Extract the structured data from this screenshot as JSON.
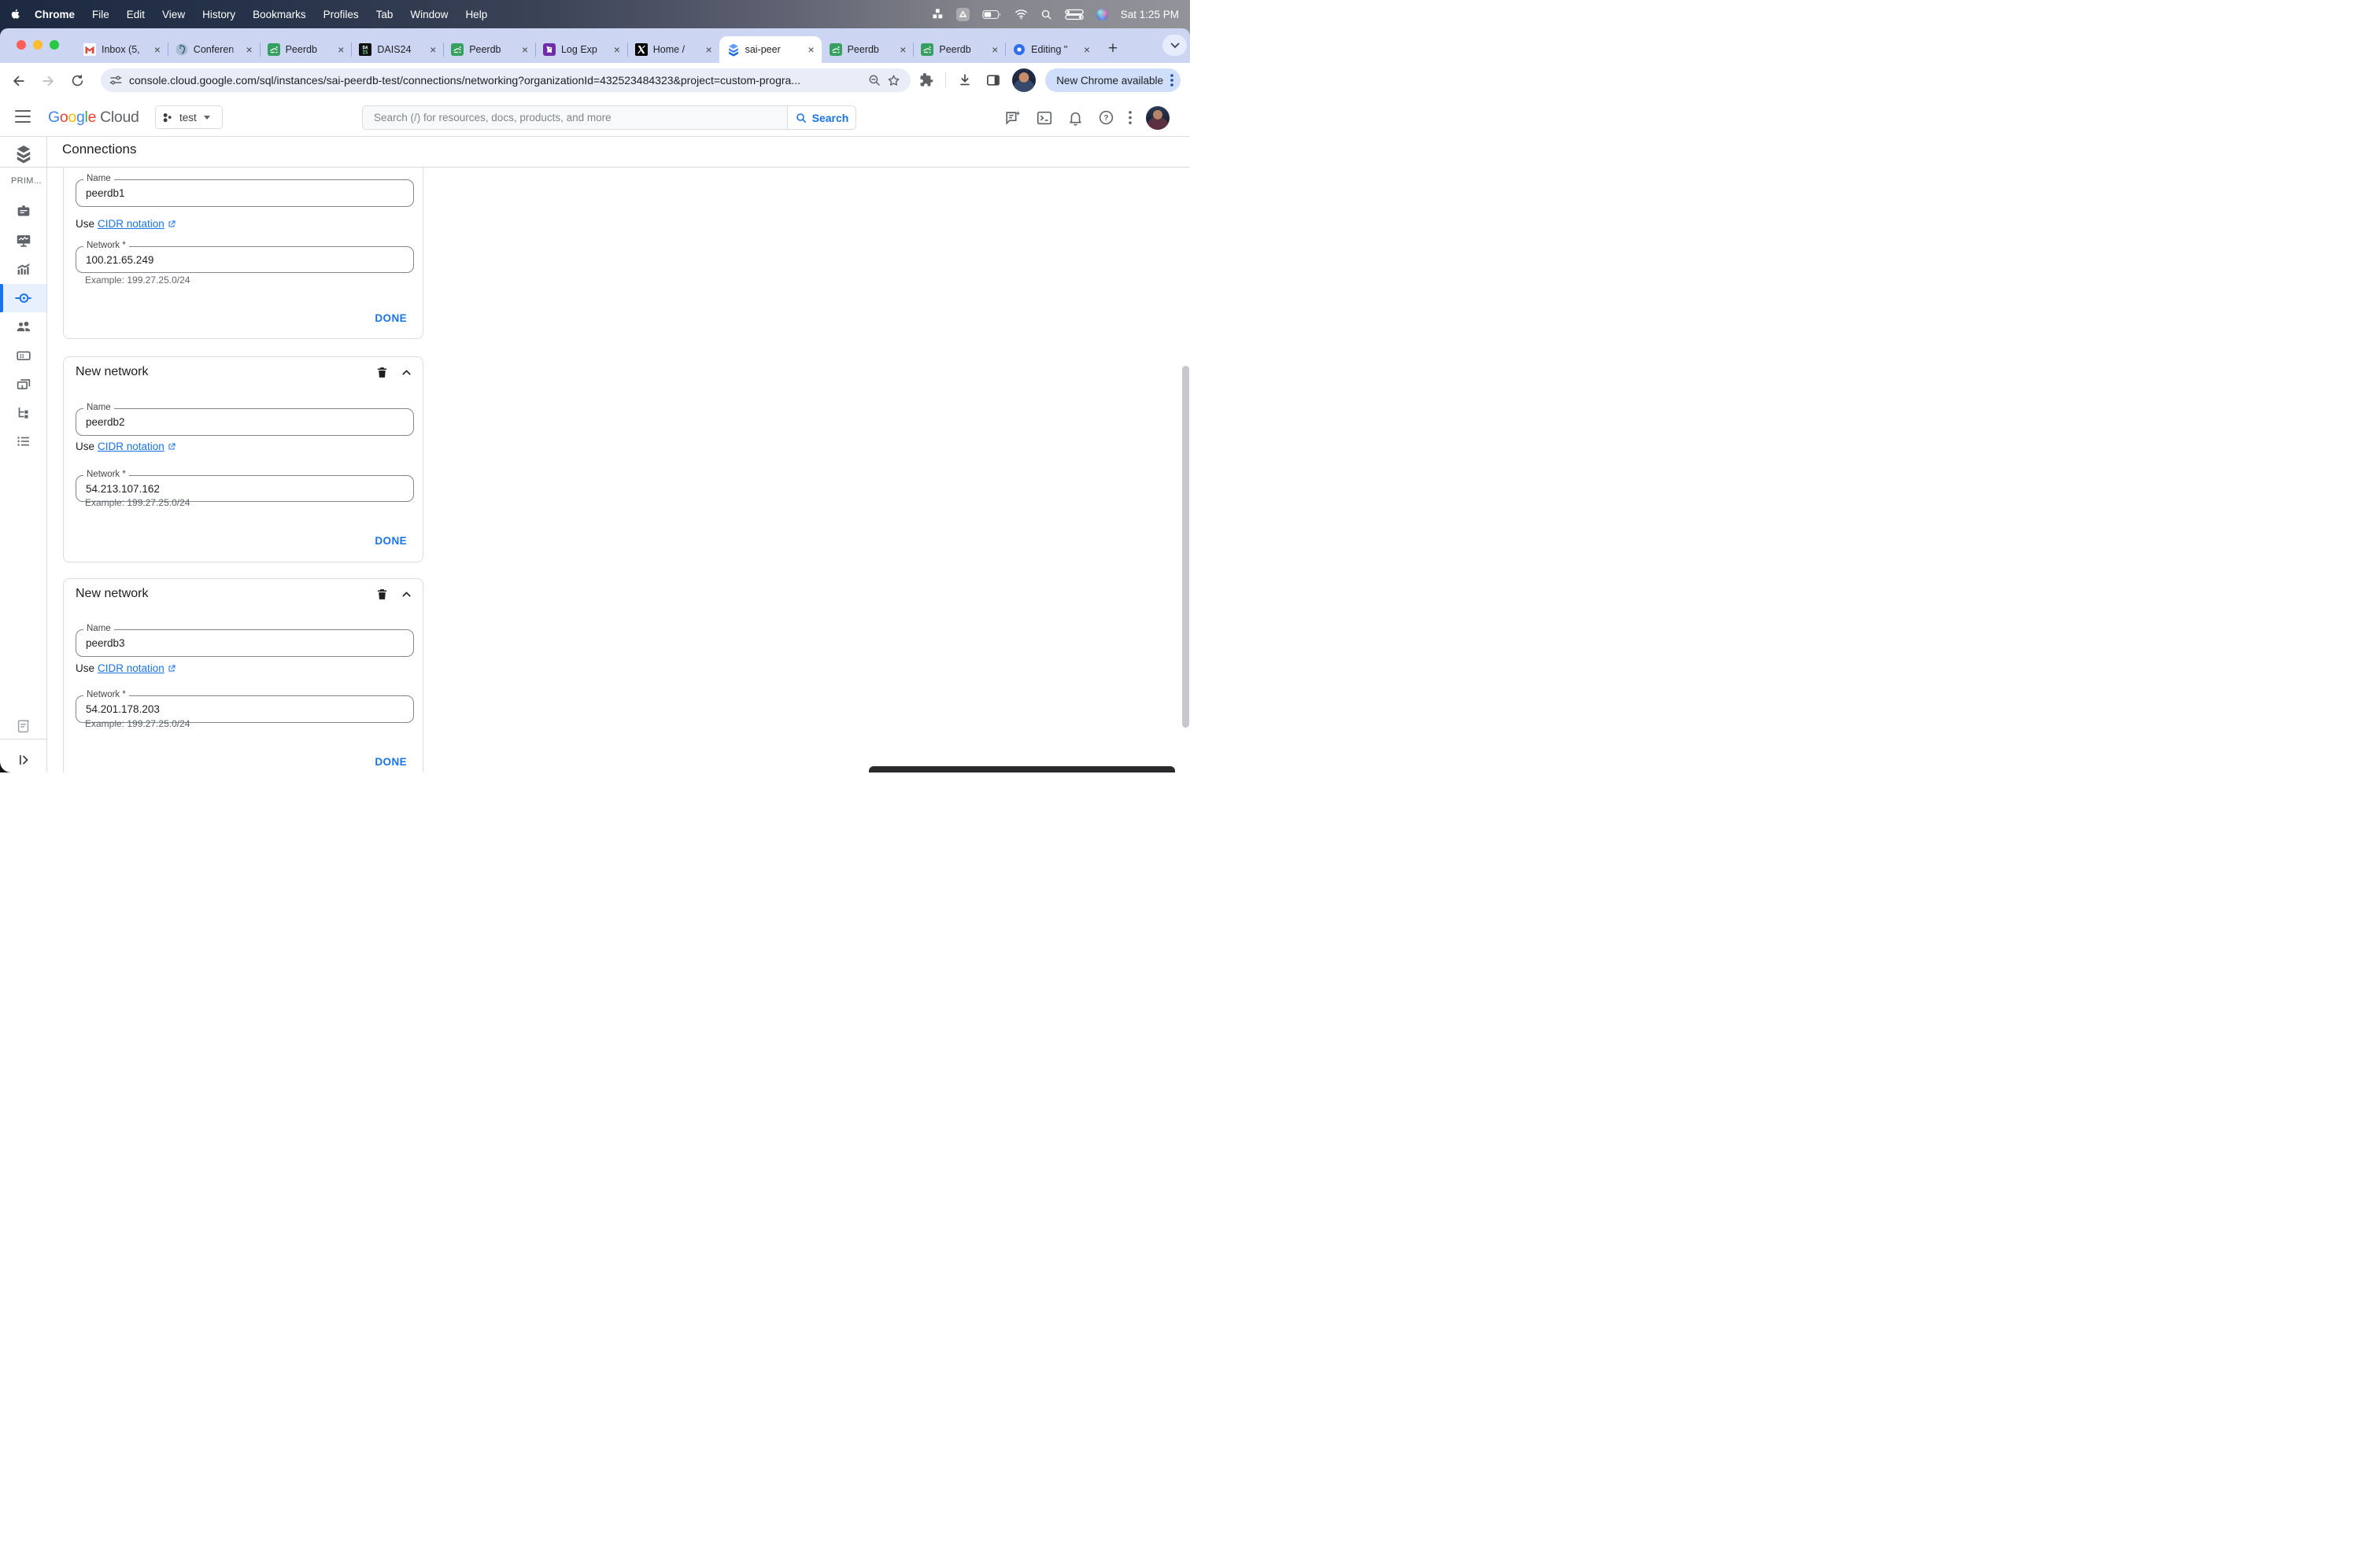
{
  "menu_bar": {
    "items": [
      "Chrome",
      "File",
      "Edit",
      "View",
      "History",
      "Bookmarks",
      "Profiles",
      "Tab",
      "Window",
      "Help"
    ],
    "clock": "Sat 1:25 PM"
  },
  "tab_strip": {
    "tabs": [
      {
        "title": "Inbox (5,",
        "icon": "gmail-icon"
      },
      {
        "title": "Conferen",
        "icon": "postgresql-icon"
      },
      {
        "title": "Peerdb",
        "icon": "peerdb-icon"
      },
      {
        "title": "DAIS24",
        "icon": "dais-icon"
      },
      {
        "title": "Peerdb",
        "icon": "peerdb-icon"
      },
      {
        "title": "Log Exp",
        "icon": "datadog-icon"
      },
      {
        "title": "Home /",
        "icon": "x-icon"
      },
      {
        "title": "sai-peer",
        "icon": "cloud-sql-icon",
        "active": true
      },
      {
        "title": "Peerdb",
        "icon": "peerdb-icon"
      },
      {
        "title": "Peerdb",
        "icon": "peerdb-icon"
      },
      {
        "title": "Editing \"",
        "icon": "blue-pin-icon"
      }
    ]
  },
  "toolbar": {
    "url": "console.cloud.google.com/sql/instances/sai-peerdb-test/connections/networking?organizationId=432523484323&project=custom-progra...",
    "update_label": "New Chrome available"
  },
  "cloud_header": {
    "logo_letters": [
      "G",
      "o",
      "o",
      "g",
      "l",
      "e"
    ],
    "logo_suffix": "Cloud",
    "project": "test",
    "search_placeholder": "Search (/) for resources, docs, products, and more",
    "search_button": "Search"
  },
  "sidebar": {
    "section_label": "PRIM..."
  },
  "page": {
    "title": "Connections",
    "cards": [
      {
        "name_label": "Name",
        "name_value": "peerdb1",
        "cidr_text": "Use",
        "cidr_link": "CIDR notation",
        "network_label": "Network *",
        "network_value": "100.21.65.249",
        "example": "Example: 199.27.25.0/24",
        "done_label": "DONE"
      },
      {
        "heading": "New network",
        "name_label": "Name",
        "name_value": "peerdb2",
        "cidr_text": "Use",
        "cidr_link": "CIDR notation",
        "network_label": "Network *",
        "network_value": "54.213.107.162",
        "example": "Example: 199.27.25.0/24",
        "done_label": "DONE"
      },
      {
        "heading": "New network",
        "name_label": "Name",
        "name_value": "peerdb3",
        "cidr_text": "Use",
        "cidr_link": "CIDR notation",
        "network_label": "Network *",
        "network_value": "54.201.178.203",
        "example": "Example: 199.27.25.0/24",
        "done_label": "DONE"
      }
    ]
  }
}
